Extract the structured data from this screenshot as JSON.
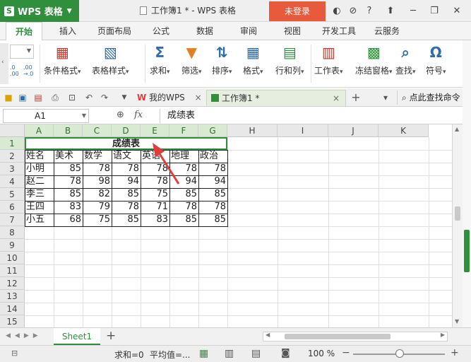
{
  "app": {
    "name": "WPS 表格",
    "window_title": "工作簿1 * - WPS 表格",
    "login_label": "未登录"
  },
  "ribbon_tabs": [
    "开始",
    "插入",
    "页面布局",
    "公式",
    "数据",
    "审阅",
    "视图",
    "开发工具",
    "云服务"
  ],
  "ribbon_buttons": [
    "条件格式",
    "表格样式",
    "求和",
    "筛选",
    "排序",
    "格式",
    "行和列",
    "工作表",
    "冻结窗格",
    "查找",
    "符号"
  ],
  "ribbon_icons": [
    "conditional-format-icon",
    "table-style-icon",
    "sum-icon",
    "filter-icon",
    "sort-icon",
    "format-icon",
    "rows-columns-icon",
    "worksheet-icon",
    "freeze-panes-icon",
    "find-icon",
    "symbol-icon"
  ],
  "ribbon_glyphs": [
    "",
    "",
    "Σ",
    "",
    "",
    "",
    "",
    "",
    "",
    "",
    "Ω"
  ],
  "ribbon_small": {
    "decimal_add": ".0\n.00",
    "decimal_remove": ".00\n→.0"
  },
  "document_tabs": {
    "wps_home": "我的WPS",
    "workbook": "工作簿1 *"
  },
  "search_command": "点此查找命令",
  "formula_bar": {
    "cell_ref": "A1",
    "fx": "fx",
    "content": "成绩表"
  },
  "columns": [
    "A",
    "B",
    "C",
    "D",
    "E",
    "F",
    "G",
    "H",
    "I",
    "J",
    "K"
  ],
  "rows": [
    "1",
    "2",
    "3",
    "4",
    "5",
    "6",
    "7",
    "8",
    "9",
    "10",
    "11",
    "12",
    "13",
    "14",
    "15"
  ],
  "sheet": {
    "title": "成绩表",
    "headers": [
      "姓名",
      "美术",
      "数学",
      "语文",
      "英语",
      "地理",
      "政治"
    ],
    "records": [
      [
        "小明",
        "85",
        "78",
        "78",
        "78",
        "78",
        "78"
      ],
      [
        "赵二",
        "78",
        "98",
        "94",
        "78",
        "94",
        "94"
      ],
      [
        "李三",
        "85",
        "82",
        "85",
        "75",
        "85",
        "85"
      ],
      [
        "王四",
        "83",
        "79",
        "78",
        "71",
        "78",
        "78"
      ],
      [
        "小五",
        "68",
        "75",
        "85",
        "83",
        "85",
        "85"
      ]
    ]
  },
  "sheet_tabs": [
    "Sheet1"
  ],
  "status": {
    "sum": "求和=0",
    "average": "平均值=...",
    "zoom": "100 %"
  },
  "colors": {
    "accent": "#2f8f3c",
    "login_bg": "#e85a3c",
    "arrow": "#e23b3b"
  }
}
